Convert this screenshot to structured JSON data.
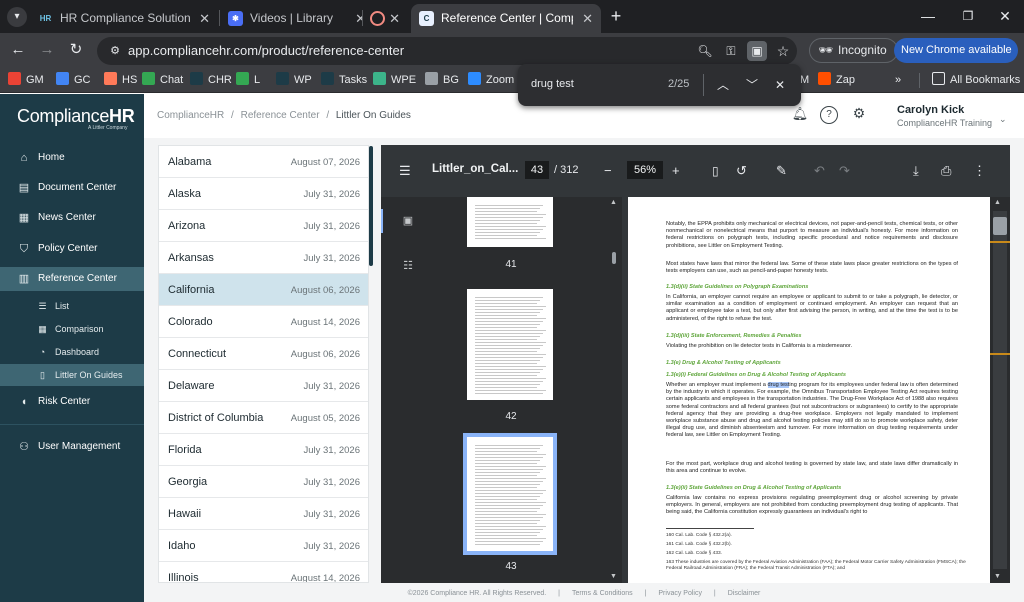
{
  "browser": {
    "tabs": [
      {
        "favicon": "HR",
        "title": "HR Compliance Solutions - Hom",
        "active": false
      },
      {
        "favicon": "loom",
        "title": "Videos | Library | Loom",
        "active": false
      },
      {
        "favicon": "rec",
        "title": "",
        "active": false
      },
      {
        "favicon": "C",
        "title": "Reference Center | Compliance",
        "active": true
      }
    ],
    "url": "app.compliancehr.com/product/reference-center",
    "incognito_label": "Incognito",
    "new_chrome_label": "New Chrome available",
    "bookmarks": [
      {
        "label": "GM",
        "icon": "gmail-icon",
        "color": "#ea4335"
      },
      {
        "label": "GC",
        "icon": "calendar-icon",
        "color": "#4285f4"
      },
      {
        "label": "HS",
        "icon": "hubspot-icon",
        "color": "#ff7a59"
      },
      {
        "label": "Chat",
        "icon": "chat-icon",
        "color": "#34a853"
      },
      {
        "label": "CHR",
        "icon": "hr-icon",
        "color": "#1d3b47"
      },
      {
        "label": "L",
        "icon": "l-icon",
        "color": "#34a853"
      },
      {
        "label": "WP",
        "icon": "hr-icon",
        "color": "#1d3b47"
      },
      {
        "label": "Tasks",
        "icon": "tasks-icon",
        "color": "#1d3b47"
      },
      {
        "label": "WPE",
        "icon": "wpe-icon",
        "color": "#3cb48a"
      },
      {
        "label": "BG",
        "icon": "globe-icon",
        "color": "#9aa0a6"
      },
      {
        "label": "Zoom",
        "icon": "zoom-icon",
        "color": "#2d8cff"
      },
      {
        "label": "M",
        "icon": "m-icon",
        "color": "#5f6368"
      },
      {
        "label": "Zap",
        "icon": "zapier-icon",
        "color": "#ff4f00"
      }
    ],
    "all_bookmarks_label": "All Bookmarks",
    "find": {
      "query": "drug test",
      "count": "2/25"
    }
  },
  "sidebar": {
    "logo_text": "Compliance",
    "logo_bold": "HR",
    "logo_sub": "A Littler Company",
    "items": [
      {
        "label": "Home",
        "icon": "home-icon"
      },
      {
        "label": "Document Center",
        "icon": "document-icon"
      },
      {
        "label": "News Center",
        "icon": "news-icon"
      },
      {
        "label": "Policy Center",
        "icon": "shield-icon"
      },
      {
        "label": "Reference Center",
        "icon": "book-icon"
      },
      {
        "label": "Risk Center",
        "icon": "shield-half-icon"
      },
      {
        "label": "User Management",
        "icon": "users-icon"
      }
    ],
    "subitems": [
      {
        "label": "List",
        "icon": "list-icon"
      },
      {
        "label": "Comparison",
        "icon": "grid-icon"
      },
      {
        "label": "Dashboard",
        "icon": "gauge-icon"
      },
      {
        "label": "Littler On Guides",
        "icon": "guide-icon"
      }
    ]
  },
  "header": {
    "breadcrumbs": [
      "ComplianceHR",
      "/",
      "Reference Center",
      "/",
      "Littler On Guides"
    ],
    "user_name": "Carolyn Kick",
    "user_org": "ComplianceHR Training"
  },
  "states": [
    {
      "name": "Alabama",
      "date": "August 07, 2026"
    },
    {
      "name": "Alaska",
      "date": "July 31, 2026"
    },
    {
      "name": "Arizona",
      "date": "July 31, 2026"
    },
    {
      "name": "Arkansas",
      "date": "July 31, 2026"
    },
    {
      "name": "California",
      "date": "August 06, 2026"
    },
    {
      "name": "Colorado",
      "date": "August 14, 2026"
    },
    {
      "name": "Connecticut",
      "date": "August 06, 2026"
    },
    {
      "name": "Delaware",
      "date": "July 31, 2026"
    },
    {
      "name": "District of Columbia",
      "date": "August 05, 2026"
    },
    {
      "name": "Florida",
      "date": "July 31, 2026"
    },
    {
      "name": "Georgia",
      "date": "July 31, 2026"
    },
    {
      "name": "Hawaii",
      "date": "July 31, 2026"
    },
    {
      "name": "Idaho",
      "date": "July 31, 2026"
    },
    {
      "name": "Illinois",
      "date": "August 14, 2026"
    }
  ],
  "pdf": {
    "title": "Littler_on_Cal...",
    "page": "43",
    "total": "/ 312",
    "zoom": "56%",
    "thumb_numbers": [
      "41",
      "42",
      "43"
    ],
    "p1": "Notably, the EPPA prohibits only mechanical or electrical devices, not paper-and-pencil tests, chemical tests, or other nonmechanical or nonelectrical means that purport to measure an individual's honesty. For more information on federal restrictions on polygraph tests, including specific procedural and notice requirements and disclosure prohibitions, see Littler on Employment Testing.",
    "p2": "Most states have laws that mirror the federal law. Some of these state laws place greater restrictions on the types of tests employers can use, such as pencil-and-paper honesty tests.",
    "h1": "1.3(d)(ii) State Guidelines on Polygraph Examinations",
    "p3": "In California, an employer cannot require an employee or applicant to submit to or take a polygraph, lie detector, or similar examination as a condition of employment or continued employment. An employer can request that an applicant or employee take a test, but only after first advising the person, in writing, and at the time the test is to be administered, of the right to refuse the test.",
    "h2": "1.3(d)(iii) State Enforcement, Remedies & Penalties",
    "p4": "Violating the prohibition on lie detector tests in California is a misdemeanor.",
    "h3": "1.3(e) Drug & Alcohol Testing of Applicants",
    "h4": "1.3(e)(i) Federal Guidelines on Drug & Alcohol Testing of Applicants",
    "p5a": "Whether an employer must implement a ",
    "p5hl": "drug test",
    "p5b": "ing program for its employees under federal law is often determined by the industry in which it operates. For example, the Omnibus Transportation Employee Testing Act requires testing certain applicants and employees in the transportation industries. The Drug-Free Workplace Act of 1988 also requires some federal contractors and all federal grantees (but not subcontractors or subgrantees) to certify to the appropriate federal agency that they are providing a drug-free workplace. Employers not legally mandated to implement workplace substance abuse and drug and alcohol testing policies may still do so to promote workplace safety, deter illegal drug use, and diminish absenteeism and turnover. For more information on drug testing requirements under federal law, see Littler on Employment Testing.",
    "p6": "For the most part, workplace drug and alcohol testing is governed by state law, and state laws differ dramatically in this area and continue to evolve.",
    "h5": "1.3(e)(ii) State Guidelines on Drug & Alcohol Testing of Applicants",
    "p7": "California law contains no express provisions regulating preemployment drug or alcohol screening by private employers. In general, employers are not prohibited from conducting preemployment drug testing of applicants. That being said, the California constitution expressly guarantees an individual's right to",
    "fn1": "160  Cal. Lab. Code § 432.2(a).",
    "fn2": "161  Cal. Lab. Code § 432.2(b).",
    "fn3": "162  Cal. Lab. Code § 433.",
    "fn4": "163  These industries are covered by the Federal Aviation Administration (FAA); the Federal Motor Carrier Safety Administration (FMSCA); the Federal Railroad Administration (FRA); the Federal Transit Administration (FTA); and"
  },
  "footer": {
    "copyright": "©2026 Compliance HR. All Rights Reserved.",
    "sep": "|",
    "terms": "Terms & Conditions",
    "privacy": "Privacy Policy",
    "disclaimer": "Disclaimer"
  }
}
